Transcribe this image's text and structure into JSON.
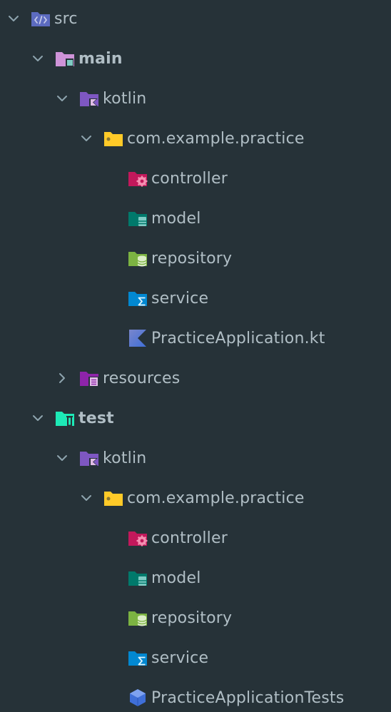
{
  "tree": {
    "src": "src",
    "main": "main",
    "main_kotlin": "kotlin",
    "main_package": "com.example.practice",
    "main_controller": "controller",
    "main_model": "model",
    "main_repository": "repository",
    "main_service": "service",
    "main_app_file": "PracticeApplication.kt",
    "resources": "resources",
    "test": "test",
    "test_kotlin": "kotlin",
    "test_package": "com.example.practice",
    "test_controller": "controller",
    "test_model": "model",
    "test_repository": "repository",
    "test_service": "service",
    "test_app_file": "PracticeApplicationTests"
  },
  "icons": {
    "src": "source-root-folder-icon",
    "main": "module-folder-icon",
    "kotlin": "kotlin-source-folder-icon",
    "package": "package-folder-icon",
    "controller": "controller-folder-icon",
    "model": "model-folder-icon",
    "repository": "repository-folder-icon",
    "service": "service-folder-icon",
    "kotlin_file": "kotlin-file-icon",
    "resources": "resources-folder-icon",
    "test": "test-folder-icon",
    "test_class": "test-class-icon"
  },
  "colors": {
    "background": "#263238",
    "text": "#b0bec5",
    "arrow": "#8ea4ae"
  }
}
